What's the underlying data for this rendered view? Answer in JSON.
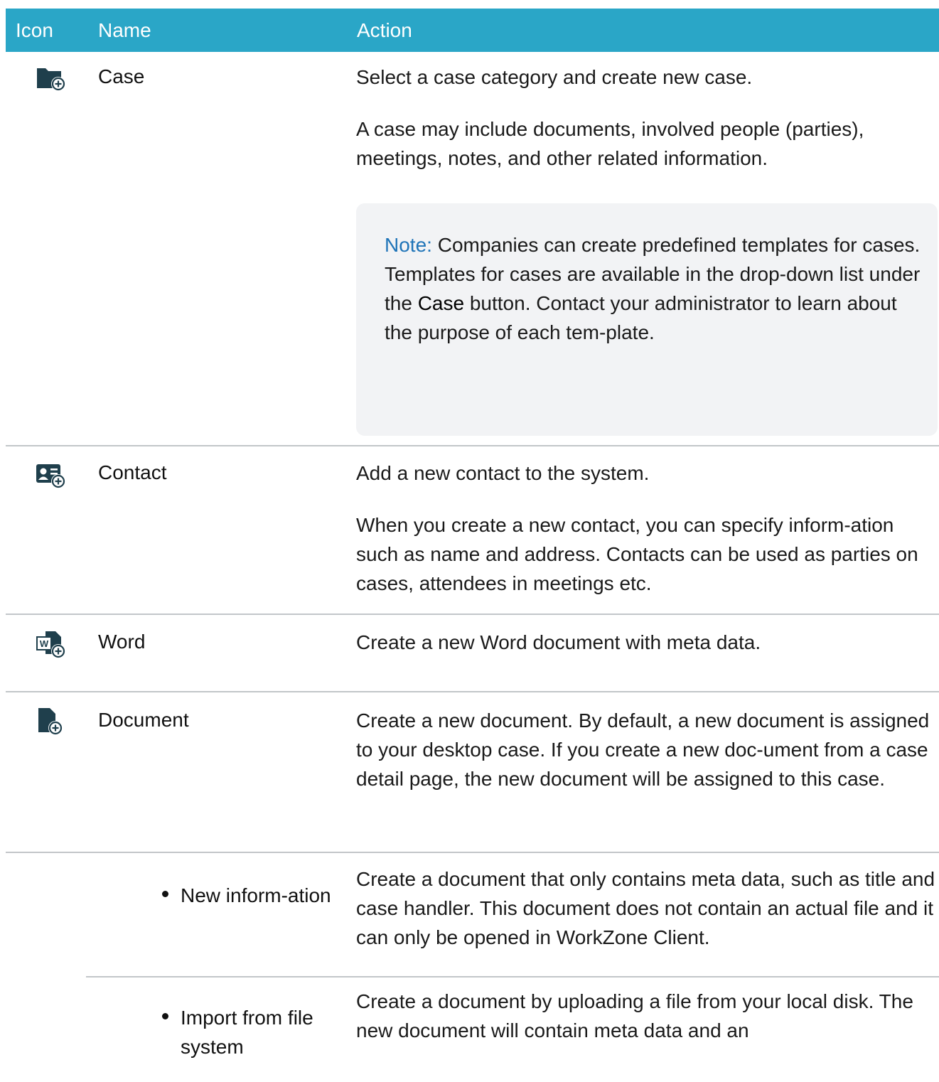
{
  "table": {
    "headers": {
      "icon": "Icon",
      "name": "Name",
      "action": "Action"
    },
    "rows": {
      "case": {
        "icon": "folder-add-icon",
        "name": "Case",
        "action_p1": "Select a case category and create new case.",
        "action_p2": "A case may include documents, involved people (parties), meetings, notes, and other related information.",
        "note": {
          "label": "Note:",
          "text_1": " Companies can create predefined templates for cases. Templates for cases are available in the drop-down list under the ",
          "bold": "Case",
          "text_2": " button. Contact your administrator to learn about the purpose of each tem-plate."
        }
      },
      "contact": {
        "icon": "contact-card-add-icon",
        "name": "Contact",
        "action_p1": "Add a new contact to the system.",
        "action_p2": "When you create a new contact, you can specify inform-ation such as name and address. Contacts can be used as parties on cases, attendees in meetings etc."
      },
      "word": {
        "icon": "word-document-add-icon",
        "name": "Word",
        "action_p1": "Create a new Word document with meta data."
      },
      "document": {
        "icon": "document-add-icon",
        "name": "Document",
        "action_p1": "Create a new document. By default, a new document is assigned to your desktop case. If you create a new doc-ument from a case detail page, the new document will be assigned to this case."
      },
      "new_information": {
        "name": "New inform-ation",
        "action_p1": "Create a document that only contains meta data, such as title and case handler. This document does not contain an actual file and it can only be opened in WorkZone Client."
      },
      "import_file": {
        "name": "Import from file system",
        "action_p1": "Create a document by uploading a file from your local disk. The new document will contain meta data and an"
      }
    }
  },
  "colors": {
    "header_bg": "#2aa6c7",
    "icon_fill": "#1f3f4c",
    "note_label": "#1f74b8",
    "note_bg": "#f2f3f5",
    "separator": "#c2c6c9"
  }
}
